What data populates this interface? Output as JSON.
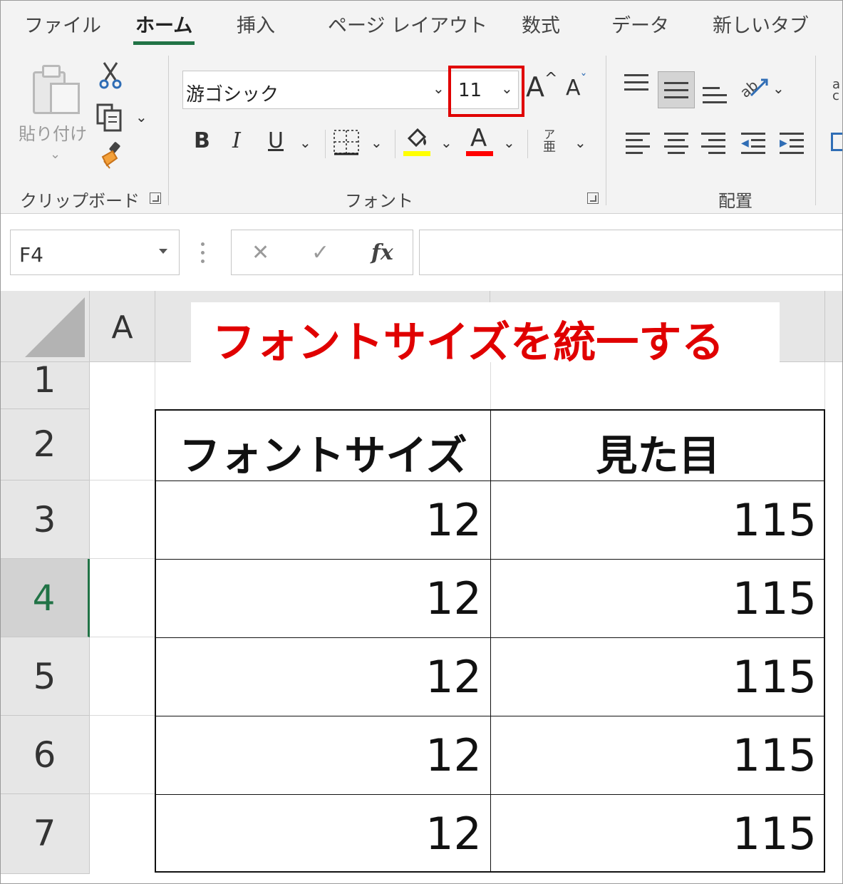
{
  "ribbon": {
    "tabs": [
      "ファイル",
      "ホーム",
      "挿入",
      "ページ レイアウト",
      "数式",
      "データ",
      "新しいタブ"
    ],
    "active_tab": "ホーム",
    "clipboard": {
      "paste_label": "貼り付け",
      "group_label": "クリップボード"
    },
    "font": {
      "name": "游ゴシック",
      "size": "11",
      "group_label": "フォント",
      "bold": "B",
      "italic": "I",
      "underline": "U",
      "font_color_glyph": "A",
      "grow_glyph": "A",
      "shrink_glyph": "A",
      "phonetic_top": "ア",
      "phonetic_bottom": "亜",
      "fill_color": "#ffff00",
      "font_color": "#ff0000"
    },
    "alignment": {
      "group_label": "配置"
    }
  },
  "formula_bar": {
    "name_box": "F4",
    "cancel": "✕",
    "enter": "✓",
    "fx": "fx",
    "formula": ""
  },
  "sheet": {
    "column_headers": [
      "A"
    ],
    "row_headers": [
      "1",
      "2",
      "3",
      "4",
      "5",
      "6",
      "7"
    ],
    "active_row": "4",
    "banner": "フォントサイズを統一する",
    "table": {
      "headers": [
        "フォントサイズ",
        "見た目"
      ],
      "rows": [
        [
          "12",
          "115"
        ],
        [
          "12",
          "115"
        ],
        [
          "12",
          "115"
        ],
        [
          "12",
          "115"
        ],
        [
          "12",
          "115"
        ]
      ]
    }
  },
  "colors": {
    "accent_green": "#217346",
    "highlight_red": "#e00000"
  }
}
